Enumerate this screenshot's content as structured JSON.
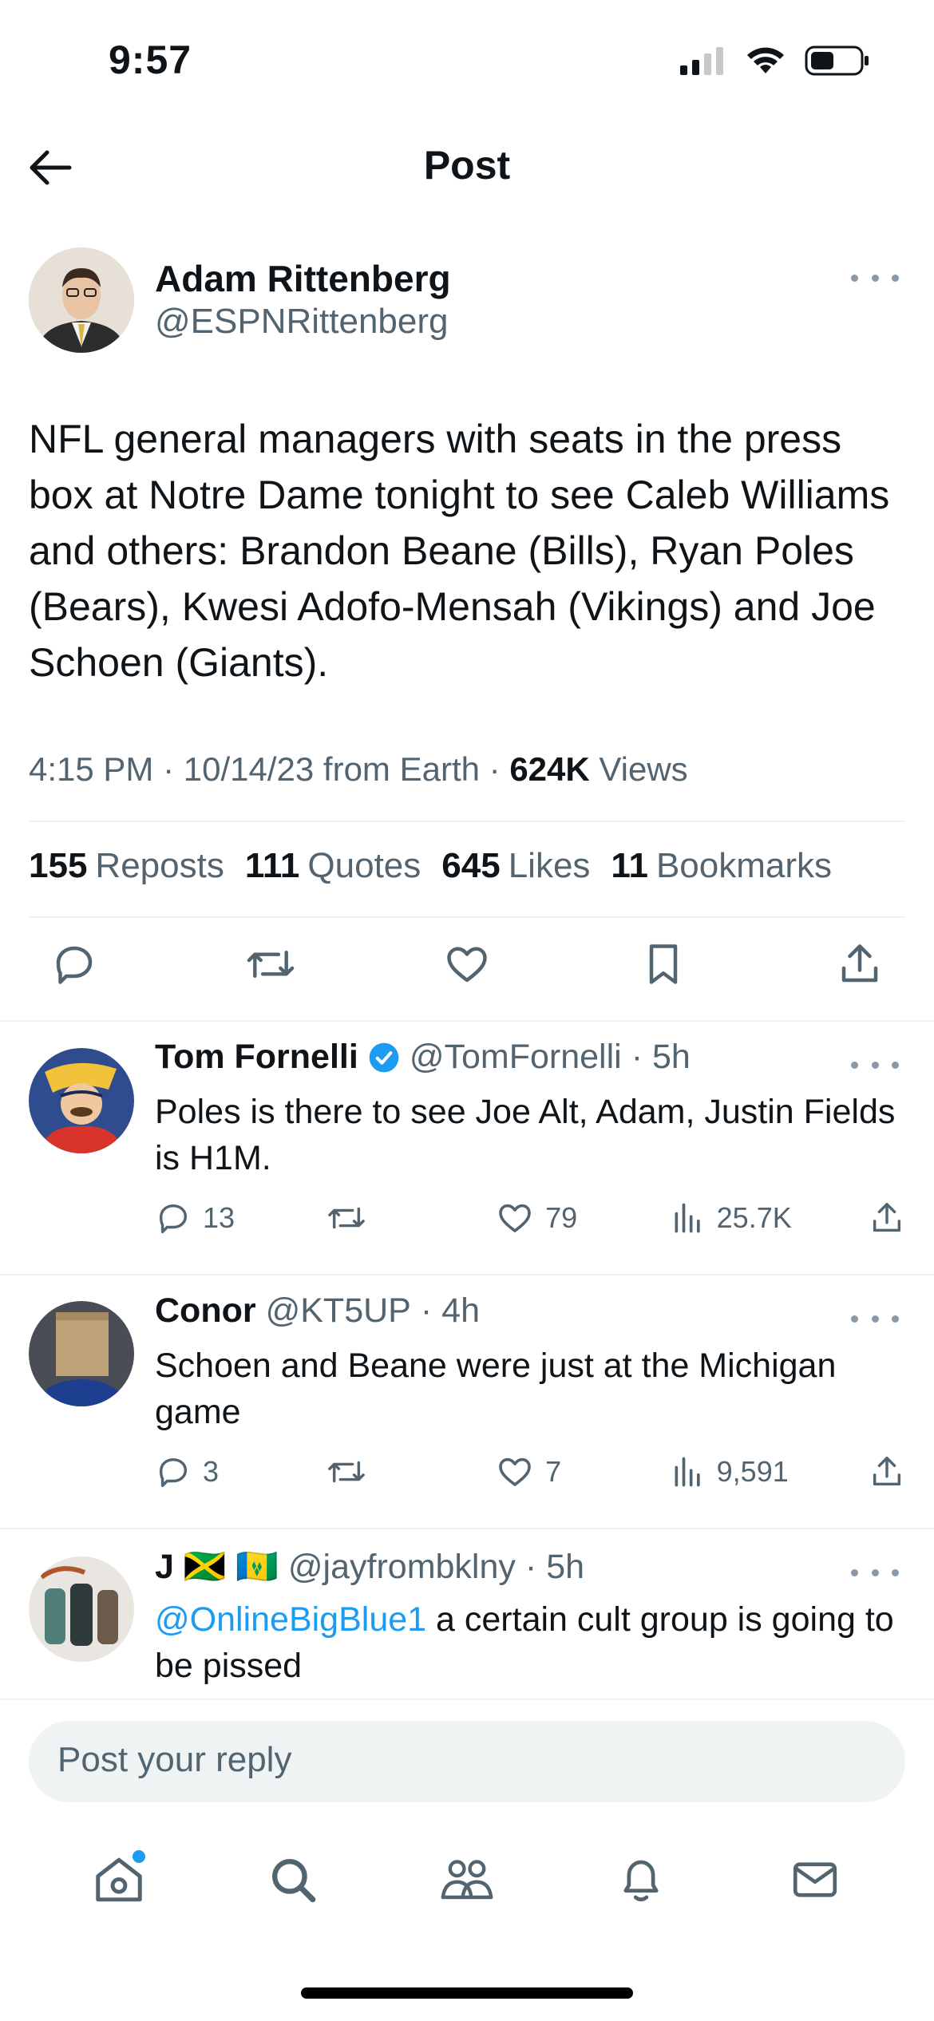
{
  "status_bar": {
    "time": "9:57"
  },
  "header": {
    "title": "Post"
  },
  "main_post": {
    "author_name": "Adam Rittenberg",
    "author_handle": "@ESPNRittenberg",
    "body": "NFL general managers with seats in the press box at Notre Dame tonight to see Caleb Williams and others: Brandon Beane (Bills), Ryan Poles (Bears), Kwesi Adofo-Mensah (Vikings) and Joe Schoen (Giants).",
    "time": "4:15 PM",
    "date": "10/14/23",
    "source": "from Earth",
    "views_count": "624K",
    "views_label": "Views",
    "stats": [
      {
        "count": "155",
        "label": "Reposts"
      },
      {
        "count": "111",
        "label": "Quotes"
      },
      {
        "count": "645",
        "label": "Likes"
      },
      {
        "count": "11",
        "label": "Bookmarks"
      }
    ]
  },
  "replies": [
    {
      "name": "Tom Fornelli",
      "verified": true,
      "handle": "@TomFornelli",
      "age": "5h",
      "mention": "",
      "text": "Poles is there to see Joe Alt, Adam, Justin Fields is H1M.",
      "replies": "13",
      "reposts": "",
      "likes": "79",
      "views": "25.7K"
    },
    {
      "name": "Conor",
      "verified": false,
      "handle": "@KT5UP",
      "age": "4h",
      "mention": "",
      "text": "Schoen and Beane were just at the Michigan game",
      "replies": "3",
      "reposts": "",
      "likes": "7",
      "views": "9,591"
    },
    {
      "name": "J 🇯🇲 🇻🇨",
      "verified": false,
      "handle": "@jayfrombklny",
      "age": "5h",
      "mention": "@OnlineBigBlue1",
      "text": " a certain cult group is going to be pissed"
    }
  ],
  "reply_box": {
    "placeholder": "Post your reply"
  },
  "nav": [
    "home-icon",
    "search-icon",
    "communities-icon",
    "notifications-icon",
    "messages-icon"
  ],
  "colors": {
    "accent": "#1d9bf0",
    "secondary_text": "#536471",
    "divider": "#eff3f4"
  }
}
